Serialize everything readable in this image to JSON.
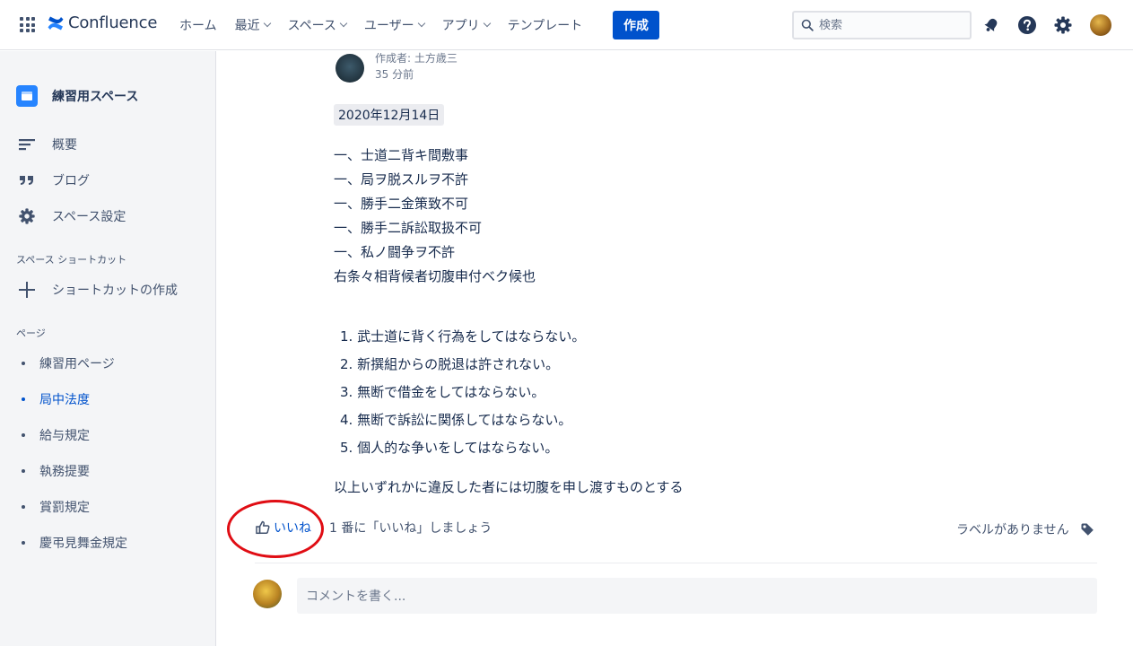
{
  "app": {
    "name": "Confluence"
  },
  "nav": {
    "items": [
      {
        "label": "ホーム",
        "dropdown": false
      },
      {
        "label": "最近",
        "dropdown": true
      },
      {
        "label": "スペース",
        "dropdown": true
      },
      {
        "label": "ユーザー",
        "dropdown": true
      },
      {
        "label": "アプリ",
        "dropdown": true
      },
      {
        "label": "テンプレート",
        "dropdown": false
      }
    ],
    "create_label": "作成",
    "search_placeholder": "検索"
  },
  "colors": {
    "accent": "#0052cc",
    "highlight": "#e00d14",
    "sidebar_bg": "#f4f5f7"
  },
  "sidebar": {
    "space_name": "練習用スペース",
    "links": [
      {
        "label": "概要",
        "icon": "overview-icon"
      },
      {
        "label": "ブログ",
        "icon": "quote-icon"
      },
      {
        "label": "スペース設定",
        "icon": "gear-icon"
      }
    ],
    "shortcuts_heading": "スペース ショートカット",
    "add_shortcut_label": "ショートカットの作成",
    "pages_heading": "ページ",
    "pages": [
      {
        "label": "練習用ページ",
        "active": false
      },
      {
        "label": "局中法度",
        "active": true
      },
      {
        "label": "給与規定",
        "active": false
      },
      {
        "label": "執務提要",
        "active": false
      },
      {
        "label": "賞罰規定",
        "active": false
      },
      {
        "label": "慶弔見舞金規定",
        "active": false
      }
    ]
  },
  "page": {
    "author": "作成者: 土方歳三",
    "time": "35 分前",
    "date": "2020年12月14日",
    "body_lines": [
      "一、士道二背キ間敷事",
      "一、局ヲ脱スルヲ不許",
      "一、勝手二金策致不可",
      "一、勝手二訴訟取扱不可",
      "一、私ノ闘争ヲ不許",
      "右条々相背候者切腹申付ベク候也"
    ],
    "ordered_list": [
      "1. 武士道に背く行為をしてはならない。",
      "2. 新撰組からの脱退は許されない。",
      "3. 無断で借金をしてはならない。",
      "4. 無断で訴訟に関係してはならない。",
      "5. 個人的な争いをしてはならない。"
    ],
    "closing": "以上いずれかに違反した者には切腹を申し渡すものとする",
    "like_label": "いいね",
    "like_hint": "1 番に「いいね」しましょう",
    "labels_text": "ラベルがありません",
    "comment_placeholder": "コメントを書く..."
  }
}
